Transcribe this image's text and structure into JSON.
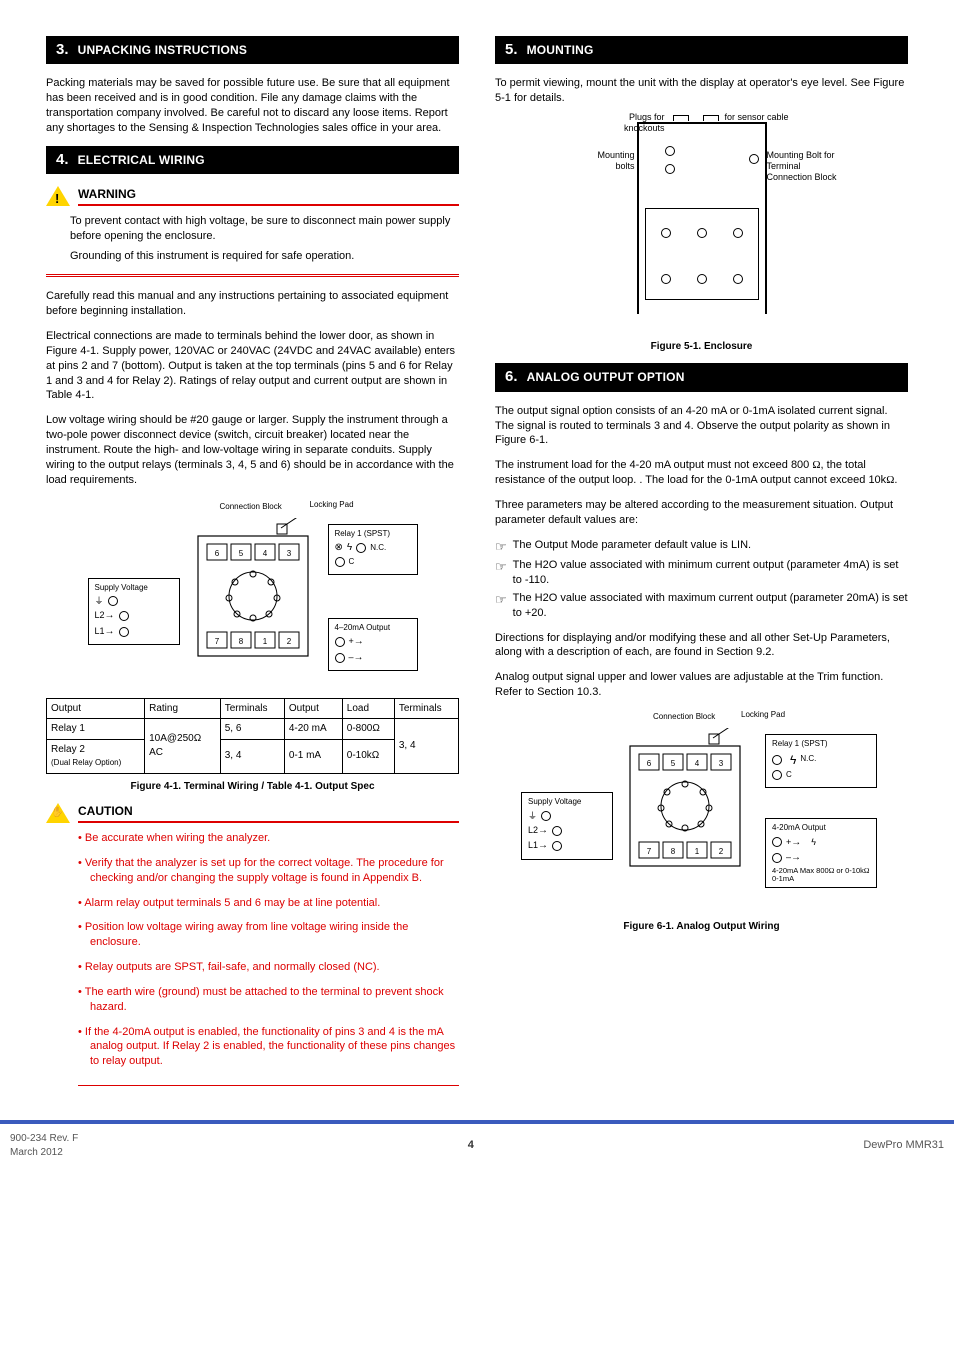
{
  "sec3": {
    "num": "3.",
    "title": "UNPACKING INSTRUCTIONS",
    "p1": "Packing materials may be saved for possible future use.  Be sure that all equipment has been received and is in good condition.  File any damage claims with the transportation company involved.  Be careful not to discard any loose items.  Report any shortages to the Sensing & Inspection Technologies sales office in your area."
  },
  "sec4": {
    "num": "4.",
    "title": "ELECTRICAL WIRING",
    "warn_label": "WARNING",
    "warn1": "To prevent contact with high voltage, be sure to disconnect main power supply before opening the enclosure.",
    "warn2": "Grounding of this instrument is required for safe operation.",
    "p1": "Carefully read this manual and any instructions pertaining to associated equipment before beginning installation.",
    "p2": "Electrical connections are made to terminals behind the lower door, as shown in Figure 4-1.  Supply power, 120VAC or 240VAC (24VDC and 24VAC available) enters at pins 2 and 7 (bottom).  Output is taken at the top terminals (pins 5 and 6 for Relay 1 and 3 and 4 for Relay 2).  Ratings of relay output and current output are shown in Table 4-1.",
    "p3": "Low voltage wiring should be #20 gauge or larger.  Supply the instrument through a two-pole power disconnect device (switch, circuit breaker) located near the instrument.  Route the high- and low-voltage wiring in separate conduits.  Supply wiring to the output relays (terminals 3, 4, 5 and 6) should be in accordance with the load requirements.",
    "fig41_caption_a": "Figure 4-1.  Terminal Wiring /",
    "fig41_caption_b": "Table 4-1.  Output Spec",
    "diag": {
      "lock_pad": "Locking Pad",
      "conn_block": "Connection Block",
      "supply_title": "Supply Voltage",
      "supply_gnd_label": "Ground",
      "supply_L2": "L2",
      "supply_L1": "L1",
      "relay1_title": "Relay 1 (SPST)",
      "relay1_nc": "N.C.",
      "relay1_c": "C",
      "ma_title": "4–20mA Output",
      "ma_plus": "+",
      "ma_minus": "–"
    },
    "table": {
      "h_output": "Output",
      "h_rating": "Rating",
      "h_terms": "Terminals",
      "h_output2": "Output",
      "h_load": "Load",
      "h_terms2": "Terminals",
      "r1": [
        "Relay 1",
        "10A@250Ω",
        "5, 6",
        "4-20 mA",
        "0-800Ω",
        "3, 4"
      ],
      "r2a": [
        "Relay 2",
        "10A@250Ω",
        "3, 4",
        "0-1 mA",
        "0-10kΩ",
        "3, 4"
      ],
      "r3": [
        "Relay 2",
        "AC",
        "3, 4"
      ],
      "dual_note": "(Dual Relay Option)"
    },
    "caut_label": "CAUTION",
    "caut_lines": [
      "Be accurate when wiring the analyzer.",
      "Verify that the analyzer is set up for the correct voltage.  The procedure for checking and/or changing the supply voltage is found in Appendix B.",
      "Alarm relay output terminals 5 and 6 may be at line potential.",
      "Position low voltage wiring away from line voltage wiring inside the enclosure.",
      "Relay outputs are SPST, fail-safe, and normally closed (NC).",
      "The earth wire (ground) must be attached to the terminal to prevent shock hazard.",
      "If the 4-20mA output is enabled, the functionality of pins 3 and 4 is the mA analog output.  If Relay 2 is enabled, the functionality of these pins changes to relay output."
    ]
  },
  "sec5": {
    "num": "5.",
    "title": "MOUNTING",
    "p1": "To permit viewing, mount the unit with the display at operator's eye level.  See Figure 5-1 for details.",
    "lead_bolts": "Mounting bolts",
    "lead_conn": "Mounting Bolt for Terminal Connection Block",
    "lead_sensor_top": "Plugs for knockouts",
    "lead_sensor_side": "for sensor cable",
    "caption": "Figure 5-1.  Enclosure"
  },
  "sec6": {
    "num": "6.",
    "title": "ANALOG OUTPUT OPTION",
    "p1": "The output signal option consists of an 4-20 mA or 0-1mA isolated current signal.  The signal is routed to terminals 3 and 4.  Observe the output polarity as shown in Figure 6-1.",
    "p2a": "The instrument load for the 4-20 mA output must not exceed 800 ",
    "p2b": "the total resistance of the output loop.",
    "p2_ohm1": "Ω",
    "p2c": ".  The load for the 0-1mA output cannot exceed 10k",
    "p2_ohm2": "Ω",
    "p3": "Three parameters may be altered according to the measurement situation.  Output parameter default values are:",
    "kps": [
      "The Output Mode parameter default value is LIN.",
      "The H2O value associated with minimum current output (parameter 4mA) is set to -110.",
      "The H2O value associated with maximum current output (parameter 20mA) is set to +20."
    ],
    "p4": "Directions for displaying and/or modifying these and all other Set-Up Parameters, along with a description of each, are found in Section 9.2.",
    "p5": "Analog output signal upper and lower values are adjustable at the Trim function.  Refer to Section 10.3.",
    "diag": {
      "lock_pad": "Locking Pad",
      "conn_block": "Connection Block",
      "supply_title": "Supply Voltage",
      "supply_gnd": "Ground",
      "supply_L2": "L2",
      "supply_L1": "L1",
      "relay1_title": "Relay 1 (SPST)",
      "relay1_nc": "N.C.",
      "relay1_c": "C",
      "maout_title": "4-20mA Output",
      "maout_plus": "+",
      "maout_minus": "–",
      "load_note_a": "4-20mA Max 800",
      "load_note_ohm": "Ω",
      "load_note_b": " or 0-10k",
      "load_note_ohm2": "Ω",
      "load_note_c": " 0-1mA"
    },
    "caption": "Figure 6-1.  Analog Output Wiring"
  },
  "footer": {
    "left_a": "900-234  Rev. F",
    "left_b": "March 2012",
    "center": "4",
    "right": "DewPro MMR31"
  }
}
